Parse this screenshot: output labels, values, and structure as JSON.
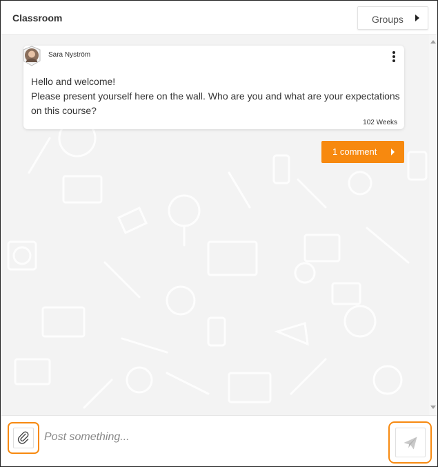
{
  "header": {
    "title": "Classroom",
    "groups_label": "Groups"
  },
  "post": {
    "author": "Sara Nyström",
    "text": "Hello and welcome!\nPlease present yourself here on the wall. Who are you and what are your expectations on this course?",
    "time": "102 Weeks",
    "comments_label": "1 comment"
  },
  "composer": {
    "placeholder": "Post something..."
  },
  "icons": {
    "groups": "caret-right-icon",
    "menu": "kebab-menu-icon",
    "comments": "caret-right-icon",
    "attach": "paperclip-icon",
    "send": "paper-plane-icon"
  },
  "colors": {
    "accent": "#f7890f",
    "wall_background": "#f3f3f3"
  }
}
